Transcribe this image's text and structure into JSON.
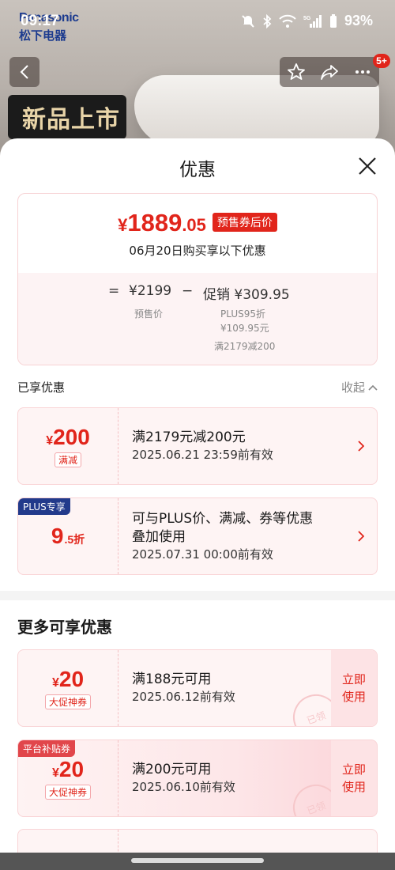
{
  "status_bar": {
    "time": "09:17",
    "battery": "93%",
    "network": "5G"
  },
  "background": {
    "brand": "Panasonic",
    "brand_cn": "松下电器",
    "new_tag": "新品上市",
    "badge": "5+"
  },
  "sheet": {
    "title": "优惠",
    "summary": {
      "currency": "¥",
      "price_int": "1889",
      "price_dec": ".05",
      "tag": "预售券后价",
      "subline": "06月20日购买享以下优惠",
      "eq": "=",
      "presale_price": "¥2199",
      "presale_label": "预售价",
      "minus": "−",
      "promo": "促销 ¥309.95",
      "promo_detail_1": "PLUS95折",
      "promo_detail_2": "¥109.95元",
      "promo_detail_3": "满2179减200"
    },
    "enjoyed_label": "已享优惠",
    "collapse_label": "收起",
    "enjoyed": [
      {
        "symbol": "¥",
        "amount": "200",
        "decimal": "",
        "type": "满减",
        "main": "满2179元减200元",
        "expiry": "2025.06.21 23:59前有效"
      },
      {
        "tag": "PLUS专享",
        "symbol": "",
        "amount": "9",
        "decimal": ".5折",
        "main_1": "可与PLUS价、满减、券等优惠",
        "main_2": "叠加使用",
        "expiry": "2025.07.31 00:00前有效"
      }
    ],
    "more_title": "更多可享优惠",
    "more": [
      {
        "symbol": "¥",
        "amount": "20",
        "type": "大促神券",
        "main": "满188元可用",
        "expiry": "2025.06.12前有效",
        "button": "立即\n使用",
        "stamp": "已领"
      },
      {
        "tag": "平台补贴券",
        "symbol": "¥",
        "amount": "20",
        "type": "大促神券",
        "main": "满200元可用",
        "expiry": "2025.06.10前有效",
        "button": "立即\n使用",
        "stamp": "已领"
      }
    ]
  },
  "colors": {
    "accent": "#e1251b",
    "plus": "#223a8b",
    "coupon_bg": "#fef4f4"
  }
}
